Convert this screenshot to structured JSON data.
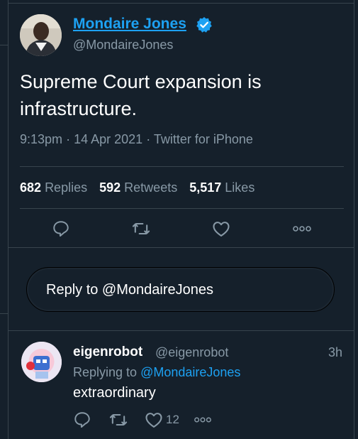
{
  "tweet": {
    "author_name": "Mondaire Jones",
    "author_handle": "@MondaireJones",
    "text": "Supreme Court expansion is infrastructure.",
    "time": "9:13pm",
    "date": "14 Apr 2021",
    "source": "Twitter for iPhone",
    "meta_sep": "·",
    "replies_count": "682",
    "replies_label": "Replies",
    "retweets_count": "592",
    "retweets_label": "Retweets",
    "likes_count": "5,517",
    "likes_label": "Likes"
  },
  "compose": {
    "placeholder": "Reply to @MondaireJones"
  },
  "reply": {
    "author_name": "eigenrobot",
    "author_handle": "@eigenrobot",
    "time": "3h",
    "replying_label": "Replying to",
    "replying_to": "@MondaireJones",
    "text": "extraordinary",
    "like_count": "12"
  },
  "icons": {
    "verified": "verified-badge-icon",
    "reply": "comment-bubble-icon",
    "retweet": "retweet-icon",
    "like": "heart-icon",
    "more": "more-dots-icon"
  },
  "colors": {
    "background": "#15202b",
    "accent": "#1da1f2",
    "secondary_text": "#8899a6",
    "border": "#38444d"
  }
}
